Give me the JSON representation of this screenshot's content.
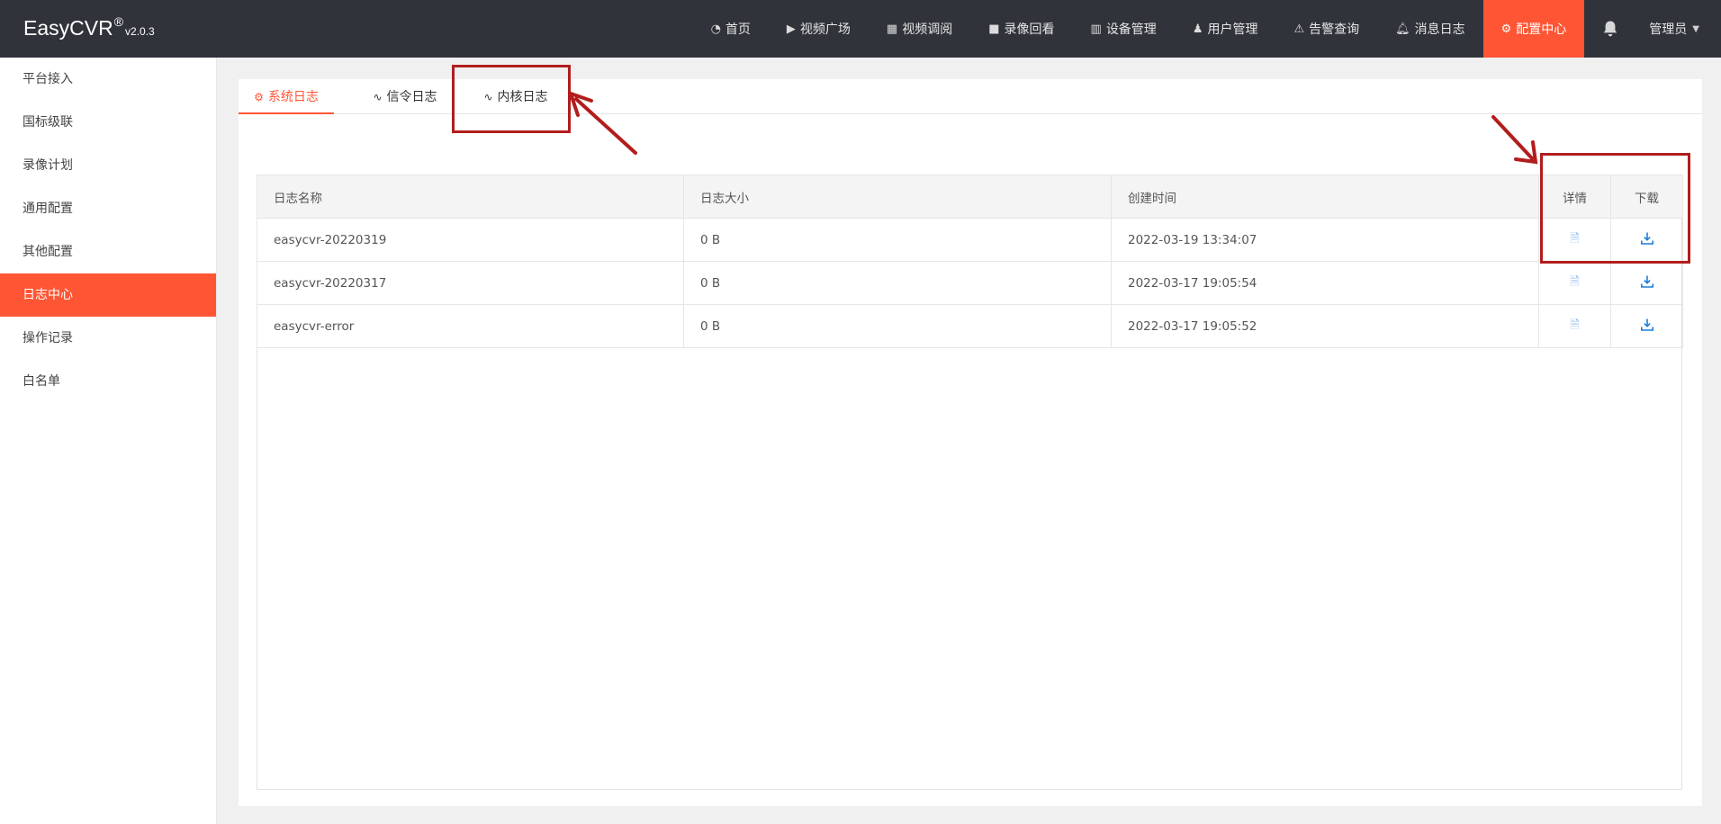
{
  "header": {
    "brand_name": "EasyCVR",
    "brand_reg": "®",
    "version": "v2.0.3",
    "nav": [
      {
        "label": "首页",
        "icon": "dashboard-icon"
      },
      {
        "label": "视频广场",
        "icon": "play-circle-icon"
      },
      {
        "label": "视频调阅",
        "icon": "layout-icon"
      },
      {
        "label": "录像回看",
        "icon": "video-camera-icon"
      },
      {
        "label": "设备管理",
        "icon": "device-grid-icon"
      },
      {
        "label": "用户管理",
        "icon": "user-gear-icon"
      },
      {
        "label": "告警查询",
        "icon": "alarm-light-icon"
      },
      {
        "label": "消息日志",
        "icon": "bell-icon"
      },
      {
        "label": "配置中心",
        "icon": "gear-icon",
        "active": true
      }
    ],
    "user_label": "管理员",
    "accent_color": "#fe5534"
  },
  "sidebar": {
    "items": [
      {
        "label": "平台接入"
      },
      {
        "label": "国标级联"
      },
      {
        "label": "录像计划"
      },
      {
        "label": "通用配置"
      },
      {
        "label": "其他配置"
      },
      {
        "label": "日志中心",
        "active": true
      },
      {
        "label": "操作记录"
      },
      {
        "label": "白名单"
      }
    ]
  },
  "tabs": [
    {
      "label": "系统日志",
      "icon": "gear-icon",
      "active": true
    },
    {
      "label": "信令日志",
      "icon": "pulse-icon"
    },
    {
      "label": "内核日志",
      "icon": "pulse-icon"
    }
  ],
  "table": {
    "columns": [
      "日志名称",
      "日志大小",
      "创建时间",
      "详情",
      "下载"
    ],
    "rows": [
      {
        "name": "easycvr-20220319",
        "size": "0 B",
        "created": "2022-03-19 13:34:07"
      },
      {
        "name": "easycvr-20220317",
        "size": "0 B",
        "created": "2022-03-17 19:05:54"
      },
      {
        "name": "easycvr-error",
        "size": "0 B",
        "created": "2022-03-17 19:05:52"
      }
    ]
  },
  "annotation_color": "#b21d1d"
}
